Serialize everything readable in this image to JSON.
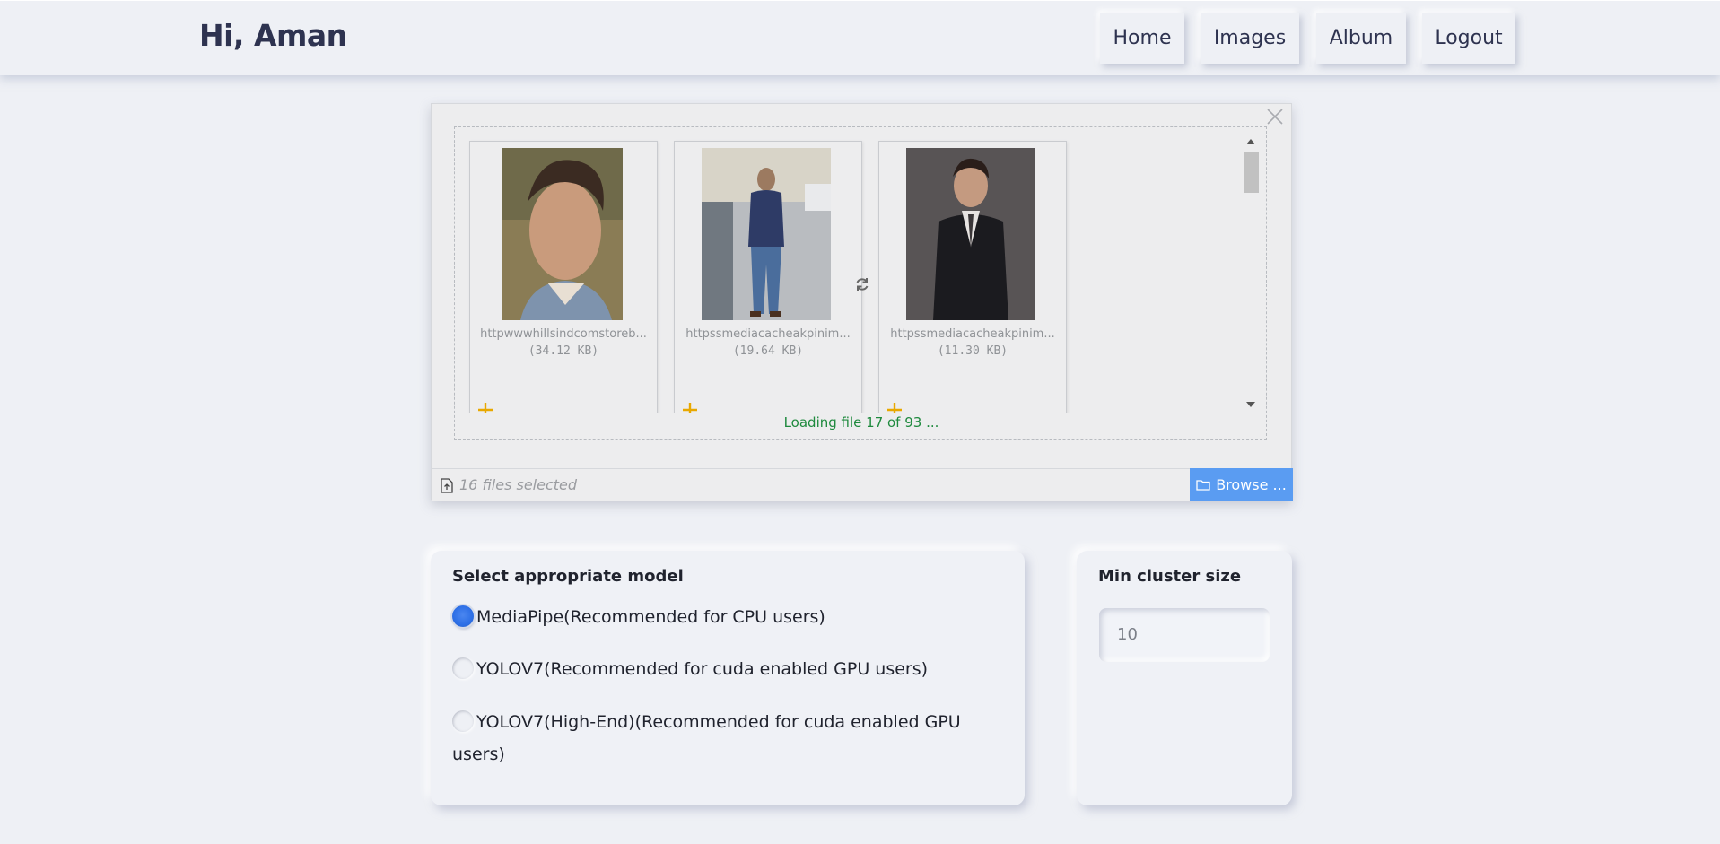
{
  "header": {
    "greeting": "Hi, Aman",
    "nav": [
      "Home",
      "Images",
      "Album",
      "Logout"
    ]
  },
  "upload": {
    "thumbnails": [
      {
        "name": "httpwwwhillsindcomstoreb...",
        "size": "(34.12 KB)"
      },
      {
        "name": "httpssmediacacheakpinim...",
        "size": "(19.64 KB)"
      },
      {
        "name": "httpssmediacacheakpinim...",
        "size": "(11.30 KB)"
      }
    ],
    "loading_text": "Loading file 17 of 93 ...",
    "caption": "16 files selected",
    "browse_label": "Browse ..."
  },
  "model_card": {
    "title": "Select appropriate model",
    "options": [
      {
        "label": "MediaPipe(Recommended for CPU users)",
        "checked": true
      },
      {
        "label": "YOLOV7(Recommended for cuda enabled GPU users)",
        "checked": false
      },
      {
        "label": "YOLOV7(High-End)(Recommended for cuda enabled GPU users)",
        "checked": false
      }
    ]
  },
  "cluster_card": {
    "title": "Min cluster size",
    "value": "10"
  },
  "colors": {
    "background": "#eef0f5",
    "browse": "#5a9cf2",
    "loading": "#1f8a3e",
    "radio_checked": "#2d6fe6"
  }
}
